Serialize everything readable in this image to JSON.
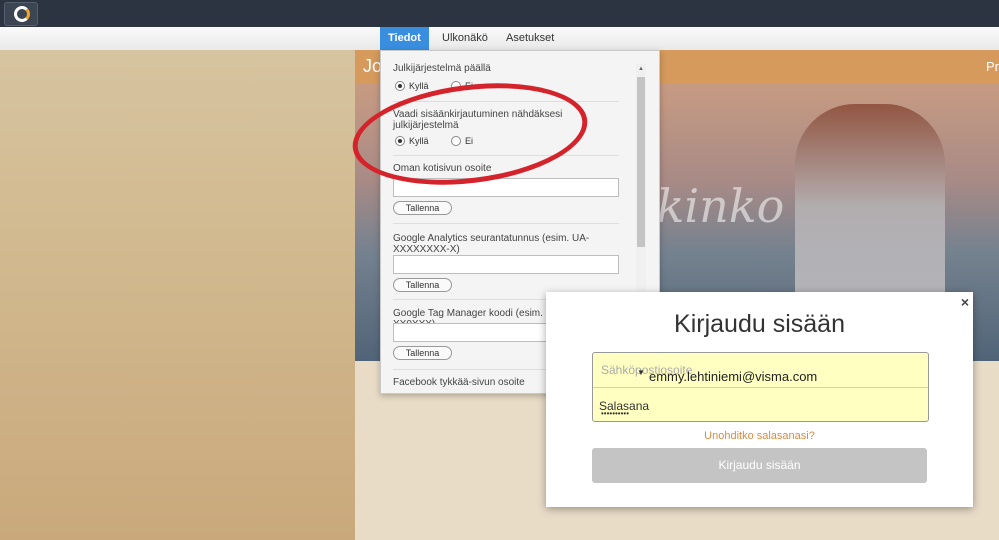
{
  "tabs": [
    "Tiedot",
    "Ulkonäkö",
    "Asetukset"
  ],
  "site": {
    "title_fragment": "Jo",
    "right_fragment": "Pr",
    "hero_text": "Joogatuokinko"
  },
  "panel": {
    "section1": {
      "label": "Julkijärjestelmä päällä",
      "yes": "Kyllä",
      "no": "Ei"
    },
    "section2": {
      "label": "Vaadi sisäänkirjautuminen nähdäksesi julkijärjestelmä",
      "yes": "Kyllä",
      "no": "Ei"
    },
    "section3": {
      "label": "Oman kotisivun osoite",
      "save": "Tallenna"
    },
    "section4": {
      "label": "Google Analytics seurantatunnus (esim. UA-XXXXXXXX-X)",
      "save": "Tallenna"
    },
    "section5": {
      "label": "Google Tag Manager koodi (esim. GTM-XX0XXX)",
      "save": "Tallenna"
    },
    "section6": {
      "label": "Facebook tykkää-sivun osoite"
    }
  },
  "login": {
    "close": "×",
    "title": "Kirjaudu sisään",
    "email_placeholder": "Sähköpostiosoite",
    "email_value": "emmy.lehtiniemi@visma.com",
    "password_placeholder": "Salasana",
    "password_value": "••••••••••",
    "forgot": "Unohditko salasanasi?",
    "submit": "Kirjaudu sisään"
  }
}
